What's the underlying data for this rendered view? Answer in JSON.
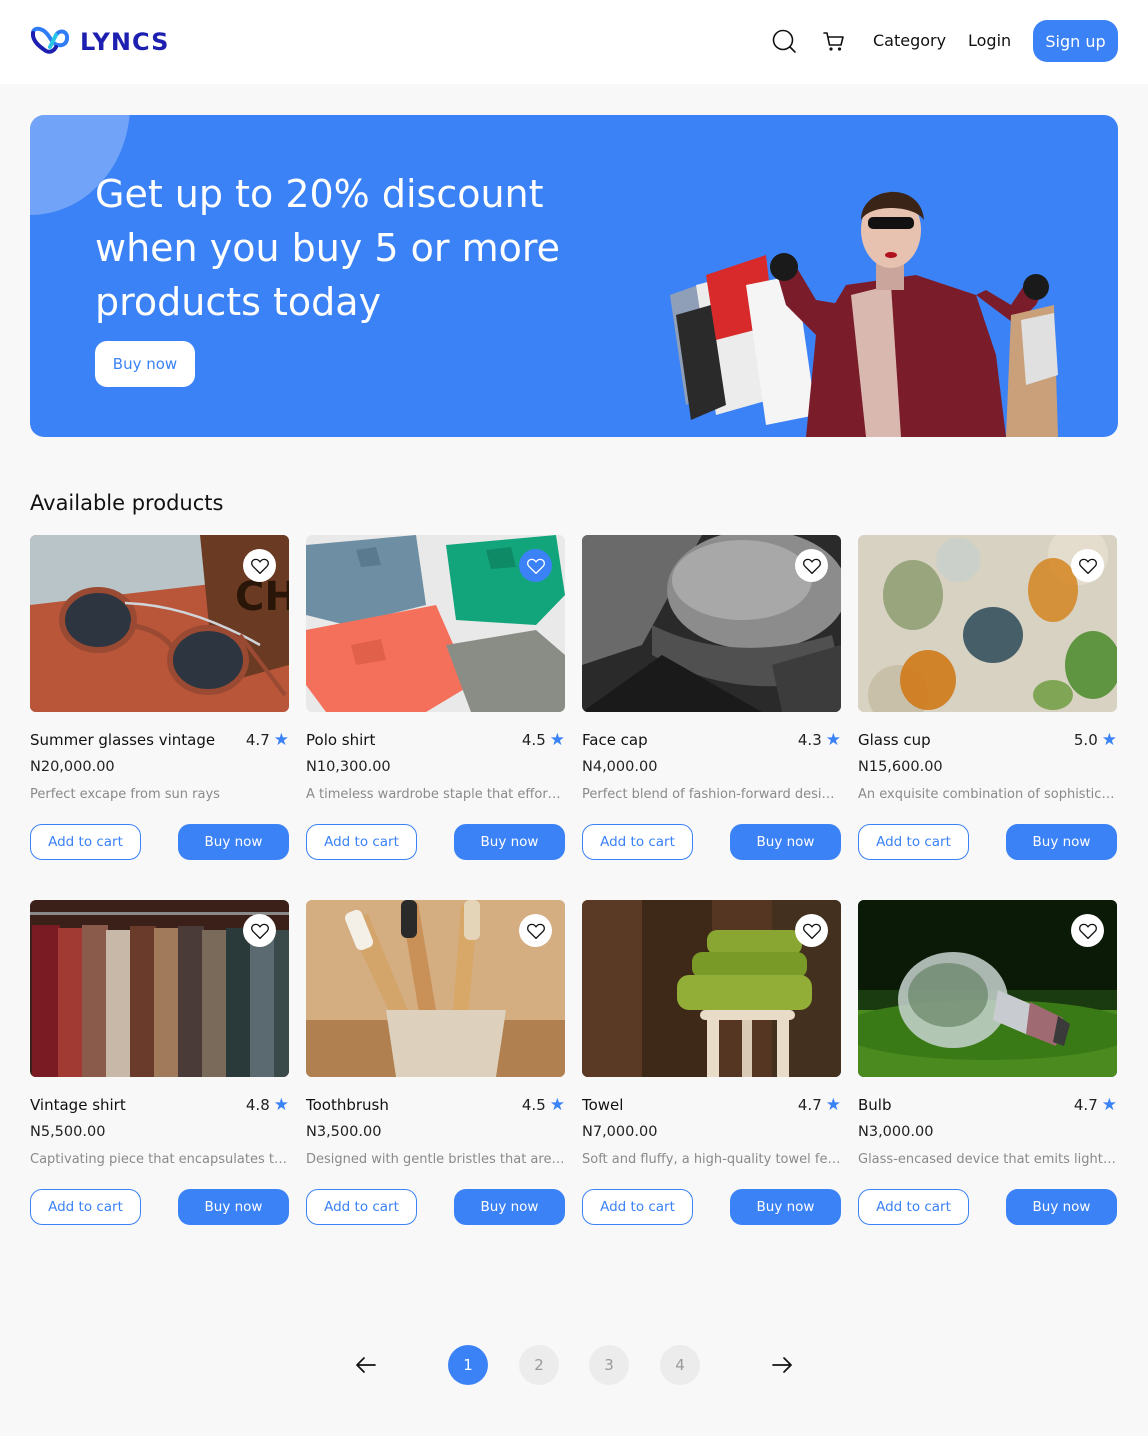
{
  "header": {
    "logo_text": "LYNCS",
    "nav": {
      "category": "Category",
      "login": "Login",
      "signup": "Sign up"
    }
  },
  "hero": {
    "title": "Get up to  20% discount when you buy 5 or more products today",
    "button": "Buy now"
  },
  "products_section": {
    "title": "Available products",
    "add_to_cart_label": "Add to cart",
    "buy_now_label": "Buy now",
    "items": [
      {
        "name": "Summer glasses vintage",
        "rating": "4.7",
        "price": "N20,000.00",
        "description": "Perfect excape from sun rays",
        "favorited": false
      },
      {
        "name": "Polo shirt",
        "rating": "4.5",
        "price": "N10,300.00",
        "description": "A timeless wardrobe staple that effortlessly blends comfort and style",
        "favorited": true
      },
      {
        "name": "Face cap",
        "rating": "4.3",
        "price": "N4,000.00",
        "description": "Perfect blend of fashion-forward design and practical sun protection",
        "favorited": false
      },
      {
        "name": "Glass cup",
        "rating": "5.0",
        "price": "N15,600.00",
        "description": "An exquisite combination of sophistication and elegance",
        "favorited": false
      },
      {
        "name": "Vintage shirt",
        "rating": "4.8",
        "price": "N5,500.00",
        "description": "Captivating piece that encapsulates timeless charm",
        "favorited": false
      },
      {
        "name": "Toothbrush",
        "rating": "4.5",
        "price": "N3,500.00",
        "description": "Designed with gentle bristles that are soft on gums",
        "favorited": false
      },
      {
        "name": "Towel",
        "rating": "4.7",
        "price": "N7,000.00",
        "description": "Soft and fluffy, a high-quality towel feels luxurious",
        "favorited": false
      },
      {
        "name": "Bulb",
        "rating": "4.7",
        "price": "N3,000.00",
        "description": "Glass-encased device that emits light when powered",
        "favorited": false
      }
    ]
  },
  "pagination": {
    "pages": [
      "1",
      "2",
      "3",
      "4"
    ],
    "current": "1"
  },
  "colors": {
    "accent": "#3b82f6",
    "logo": "#1c1fb0"
  },
  "icons": [
    "logo-mark-icon",
    "search-icon",
    "cart-icon",
    "heart-icon",
    "star-icon",
    "arrow-left-icon",
    "arrow-right-icon"
  ]
}
